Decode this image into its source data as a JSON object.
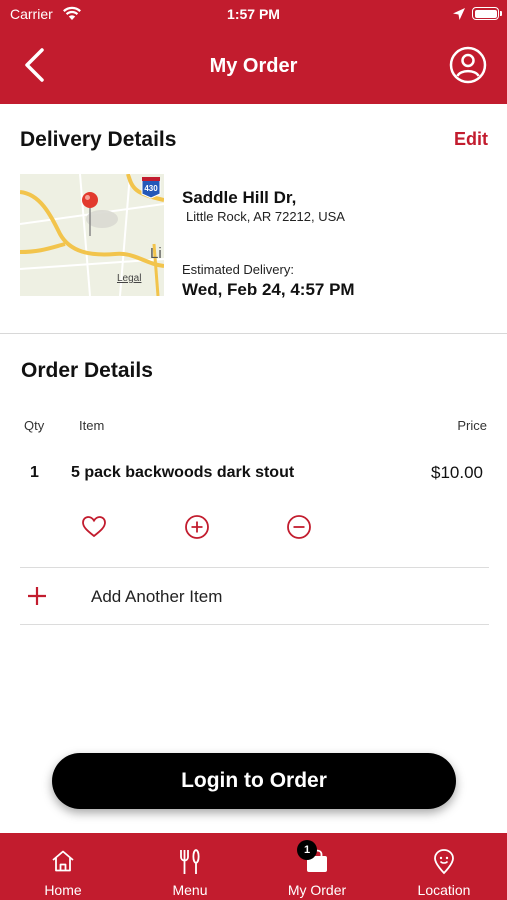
{
  "status_bar": {
    "carrier": "Carrier",
    "time": "1:57 PM"
  },
  "header": {
    "title": "My Order"
  },
  "delivery": {
    "title": "Delivery Details",
    "edit_label": "Edit",
    "street": "Saddle Hill Dr,",
    "city_line": "Little Rock, AR 72212, USA",
    "estimated_label": "Estimated Delivery:",
    "estimated_value": "Wed, Feb 24, 4:57 PM",
    "map": {
      "shield_number": "430",
      "legal_label": "Legal",
      "partial_city": "Li"
    }
  },
  "order": {
    "title": "Order Details",
    "columns": {
      "qty": "Qty",
      "item": "Item",
      "price": "Price"
    },
    "items": [
      {
        "qty": "1",
        "name": "5 pack backwoods dark stout",
        "price": "$10.00"
      }
    ],
    "add_item_label": "Add Another Item"
  },
  "login_button": "Login to Order",
  "tabs": [
    {
      "label": "Home",
      "icon": "home-icon"
    },
    {
      "label": "Menu",
      "icon": "utensils-icon"
    },
    {
      "label": "My Order",
      "icon": "bag-icon",
      "badge": "1"
    },
    {
      "label": "Location",
      "icon": "location-pin-icon"
    }
  ],
  "colors": {
    "brand_red": "#c21c2e",
    "button_black": "#000000"
  }
}
